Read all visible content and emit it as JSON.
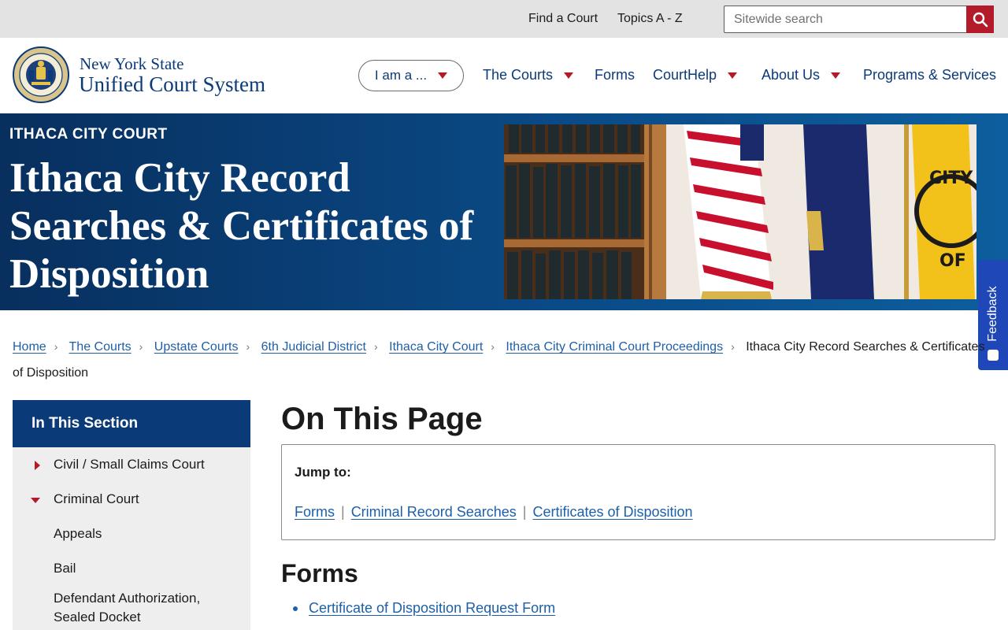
{
  "utility": {
    "find_court": "Find a Court",
    "topics": "Topics A - Z",
    "search_placeholder": "Sitewide search",
    "search_icon": "search-icon",
    "accent": "#b31b2b"
  },
  "brand": {
    "line1": "New York State",
    "line2": "Unified Court System",
    "seal_icon": "state-seal-icon"
  },
  "nav": {
    "iam": "I am a ...",
    "items": [
      {
        "label": "The Courts",
        "has_menu": true
      },
      {
        "label": "Forms",
        "has_menu": false
      },
      {
        "label": "CourtHelp",
        "has_menu": true
      },
      {
        "label": "About Us",
        "has_menu": true
      },
      {
        "label": "Programs & Services",
        "has_menu": false
      }
    ]
  },
  "hero": {
    "kicker": "ITHACA CITY COURT",
    "title": "Ithaca City Record Searches & Certificates of Disposition",
    "image": "courtroom-books-and-flags-photo"
  },
  "feedback": {
    "label": "Feedback"
  },
  "breadcrumb": {
    "links": [
      "Home",
      "The Courts",
      "Upstate Courts",
      "6th Judicial District",
      "Ithaca City Court",
      "Ithaca City Criminal Court Proceedings"
    ],
    "current": "Ithaca City Record Searches & Certificates of Disposition"
  },
  "sidebar": {
    "heading": "In This Section",
    "items": [
      {
        "label": "Civil / Small Claims Court",
        "marker": "collapsed"
      },
      {
        "label": "Criminal Court",
        "marker": "expanded"
      },
      {
        "label": "Appeals",
        "marker": "none"
      },
      {
        "label": "Bail",
        "marker": "none"
      },
      {
        "label": "Defendant Authorization, Sealed Docket",
        "marker": "none"
      }
    ]
  },
  "main": {
    "title": "On This Page",
    "jump_label": "Jump to:",
    "jump_links": [
      "Forms",
      "Criminal Record Searches",
      "Certificates of Disposition"
    ],
    "forms_heading": "Forms",
    "forms_items": [
      "Certificate of Disposition Request Form"
    ]
  },
  "colors": {
    "navy": "#0b3a78",
    "link": "#1d5fa8",
    "feedback": "#1f47b8"
  }
}
